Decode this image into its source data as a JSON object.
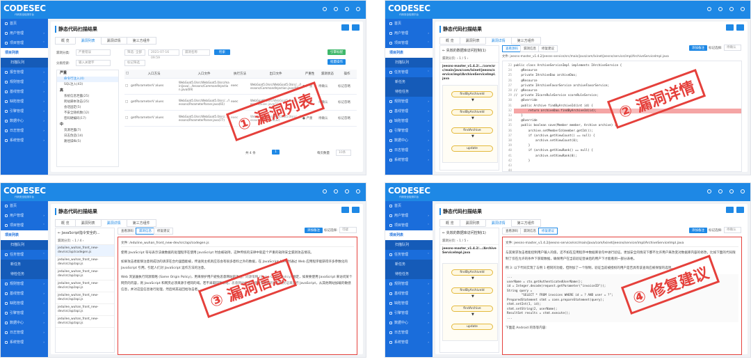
{
  "app": {
    "logo": "CODESEC",
    "logo_sub": "代码安全检测平台",
    "page_title": "静态代码扫描结果"
  },
  "tabs": [
    "概 览",
    "漏洞列表",
    "漏洞详情",
    "第三方组件"
  ],
  "sidebar": {
    "q1": [
      {
        "label": "首页"
      },
      {
        "label": "用户管理",
        "arrow": "›"
      },
      {
        "label": "项目管理",
        "arrow": "˅"
      },
      {
        "label": "项目列表",
        "active": true
      },
      {
        "label": "扫描队列",
        "sub": true
      },
      {
        "label": "报告管理",
        "arrow": "›"
      },
      {
        "label": "规则管理",
        "arrow": "›"
      },
      {
        "label": "基线管理",
        "arrow": "›"
      },
      {
        "label": "缺陷管理",
        "arrow": "›"
      },
      {
        "label": "引擎管理",
        "arrow": "›"
      },
      {
        "label": "数据中心",
        "arrow": "›"
      },
      {
        "label": "日志管理",
        "arrow": "›"
      },
      {
        "label": "系统管理",
        "arrow": "›"
      }
    ],
    "q2": [
      {
        "label": "首页"
      },
      {
        "label": "用户管理",
        "arrow": "›"
      },
      {
        "label": "项目管理",
        "arrow": "˅"
      },
      {
        "label": "项目列表",
        "active": true
      },
      {
        "label": "扫描队列",
        "sub": true
      },
      {
        "label": "任务管理",
        "arrow": "˅"
      },
      {
        "label": "新任务",
        "sub": true
      },
      {
        "label": "待检任务",
        "sub": true
      },
      {
        "label": "规则管理",
        "arrow": "›"
      },
      {
        "label": "基线管理",
        "arrow": "›"
      },
      {
        "label": "缺陷管理",
        "arrow": "›"
      },
      {
        "label": "引擎管理",
        "arrow": "›"
      },
      {
        "label": "数据中心",
        "arrow": "›"
      },
      {
        "label": "日志管理",
        "arrow": "›"
      },
      {
        "label": "系统管理",
        "arrow": "›"
      }
    ],
    "q3": [
      {
        "label": "首页"
      },
      {
        "label": "用户管理",
        "arrow": "›"
      },
      {
        "label": "项目管理",
        "arrow": "˅"
      },
      {
        "label": "项目列表",
        "active": true
      },
      {
        "label": "扫描队列",
        "sub": true
      },
      {
        "label": "任务管理",
        "arrow": "˅"
      },
      {
        "label": "新任务",
        "sub": true
      },
      {
        "label": "待检任务",
        "sub": true
      },
      {
        "label": "规则管理",
        "arrow": "›"
      },
      {
        "label": "基线管理",
        "arrow": "›"
      },
      {
        "label": "缺陷管理",
        "arrow": "›"
      },
      {
        "label": "引擎管理",
        "arrow": "›"
      },
      {
        "label": "数据中心",
        "arrow": "›"
      },
      {
        "label": "日志管理",
        "arrow": "›"
      },
      {
        "label": "系统管理",
        "arrow": "›"
      }
    ],
    "q4": [
      {
        "label": "首页"
      },
      {
        "label": "用户管理",
        "arrow": "›"
      },
      {
        "label": "项目管理",
        "arrow": "˅"
      },
      {
        "label": "项目列表",
        "active": true
      },
      {
        "label": "扫描队列",
        "sub": true
      },
      {
        "label": "任务管理",
        "arrow": "˅"
      },
      {
        "label": "新任务",
        "sub": true
      },
      {
        "label": "待检任务",
        "sub": true
      },
      {
        "label": "规则管理",
        "arrow": "›"
      },
      {
        "label": "基线管理",
        "arrow": "›"
      },
      {
        "label": "缺陷管理",
        "arrow": "›"
      },
      {
        "label": "引擎管理",
        "arrow": "›"
      },
      {
        "label": "数据中心",
        "arrow": "›"
      },
      {
        "label": "日志管理",
        "arrow": "›"
      },
      {
        "label": "系统管理",
        "arrow": "›"
      }
    ]
  },
  "q1": {
    "filter_label": "漏洞分类:",
    "filter_value": "严重错误",
    "class_label": "分类检索:",
    "class_placeholder": "输入关键字",
    "search_mode": "筛选: 全部",
    "date_value": "2021-07-16 09:59",
    "search_placeholder": "漏洞名称",
    "search_btn": "检索",
    "export_btn": "引擎标配",
    "export2_btn": "批量操作",
    "tree": [
      {
        "h": "严重"
      },
      {
        "t": "命令行注入(4)",
        "sel": true
      },
      {
        "t": "SQL注入(43)"
      },
      {
        "h": "高"
      },
      {
        "t": "系统信息泄露(25)"
      },
      {
        "t": "跨站脚本攻击(25)"
      },
      {
        "t": "会话固定(5)"
      },
      {
        "t": "不安全随机数(12)"
      },
      {
        "t": "密码硬编码(17)"
      },
      {
        "h": "中"
      },
      {
        "t": "资源泄露(7)"
      },
      {
        "t": "日志伪造(14)"
      },
      {
        "t": "路径操纵(5)"
      }
    ],
    "headers": [
      "入口方法",
      "入口文件",
      "执行方法",
      "出口文件",
      "严重性",
      "漏洞状态",
      "操作"
    ],
    "rows": [
      {
        "m": "getParameterV alues",
        "f": "WebGoat5.0/src/WebGoat5.0/src/main/java/.../lessons/CommandInjection.java(69)",
        "x": "exec",
        "o": "WebGoat5.0/src/WebGoat5.0/src/.../lessons/CommandInjection.java(98)",
        "s": "● 严重",
        "st": "待确认",
        "op": "标记忽略"
      },
      {
        "m": "getParameterV alues",
        "f": "WebGoat5.0/src/WebGoat5.0/src/.../lessons/ParameterParser.java(65)",
        "x": "exec",
        "o": "WebGoat5.0/src/WebGoat5.0/src/.../lessons/Exec.java(51)",
        "s": "● 严重",
        "st": "待确认",
        "op": "标记忽略"
      },
      {
        "m": "getParameterV alues",
        "f": "WebGoat5.0/src/WebGoat5.0/src/.../lessons/ParameterParser.java(77)",
        "x": "exec",
        "o": "WebGoat5.0/src/WebGoat5.0/src/.../lessons/Exec.java(32)",
        "s": "● 严重",
        "st": "待确认",
        "op": "标记忽略"
      }
    ],
    "pager": {
      "total": "共 4 条",
      "page": "1",
      "size_label": "每页数量",
      "size": "10条"
    },
    "stamp": "① 漏洞列表"
  },
  "q2": {
    "back": "失效的数据库访问控制(1)",
    "nav_label": "漏洞分页:",
    "page": "1",
    "of": "/ 5",
    "file": "jeesns-master_v1.4.2/.../core/src/main/java/com/lxinet/jeesns/service/impl/ArchiveServiceImpl.java",
    "subtabs": [
      "查看源码",
      "漏洞信息",
      "修复建议"
    ],
    "mark_btn": "添加备注",
    "mark_label": "标记选择:",
    "mark_value": "待确认",
    "code_path": "文件: jeesns-master_v1.4.2/jeesns-service/src/main/java/com/lxinet/jeesns/service/impl/ArchiveServiceImpl.java",
    "flow": [
      "findByArchiveId",
      "findByArchiveId",
      "findArchive",
      "update"
    ],
    "lines": [
      "23",
      "24",
      "25",
      "26",
      "27",
      "28",
      "29",
      "30",
      "31",
      "32",
      "33",
      "34",
      "35",
      "36",
      "37",
      "38",
      "39",
      "40",
      "41",
      "42",
      "43",
      "44"
    ],
    "code": [
      "public class ArchiveServiceImpl implements IArchiveService {",
      "    @Resource",
      "    private IArchiveDao archiveDao;",
      "    @Resource",
      "    private IArchiveFavorService archiveFavorService;",
      "//  @Resource",
      "//  private IScoreRuleService scoreRuleService;",
      "",
      "    @Override",
      "    public Archive findByArchiveId(int id) {",
      "        return archiveDao.findByArchiveId(id);",
      "    }",
      "",
      "    @Override",
      "    public boolean save(Member member, Archive archive) {",
      "        archive.setMemberId(member.getId());",
      "        if (archive.getViewCount() == null) {",
      "            archive.setViewCount(0);",
      "        }",
      "        if (archive.getViewRank() == null) {",
      "            archive.setViewRank(0);",
      "        }"
    ],
    "stamp": "② 漏洞详情"
  },
  "q3": {
    "back": "JavaScript指令安全的...",
    "nav_label": "漏洞分页:",
    "page": "1",
    "of": "/ 4",
    "files": [
      "jeduilee_wuhan_front_new-dev/src/api/codegen.js",
      "jeduilee_wuhan_front_new-dev/src/api/api.js",
      "jeduilee_wuhan_front_new-dev/src/api/api.js",
      "jeduilee_wuhan_front_new-dev/src/api/api.js",
      "jeduilee_wuhan_front_new-dev/src/api/api.js",
      "jeduilee_wuhan_front_new-dev/src/api/api.js",
      "jeduilee_wuhan_front_new-dev/src/api/api.js"
    ],
    "subtabs": [
      "查看源码",
      "漏洞信息",
      "修复建议"
    ],
    "mark_btn": "添加备注",
    "mark_label": "标记选择:",
    "mark_value": "可疑",
    "path": "文件: /eduline_wuhan_front_new-dev/src/api/codegen.js",
    "paras": [
      "使用 JavaScript 符号表示法做数据的处理程序在使用 JavaScript 时会被劫持，这种传统的法律中就是个严重的劫持安全漏洞攻击情况。",
      "如果攻击者能够注意到成功的请求在合约里面能被，传送到主机则应答会有很多意料之外的数据，在 JavaScript Ajax 时通过 Web 应用程序能获得许多参数化的 JavaScript 引用，引起人们对 JavaScript 运作方法的注意。",
      "Web 浏览器执行同源策略 (Same Origin Policy)，用来保护用户避免恶意网站的攻击。同源策略 (Same Origin Policy) 规定，如果要使用 JavaScript 来访问某个网页的内容，则 JavaScript 和网页必须来源于相同的域。若不采取同源策略，恶意网站便可以使用受害者的客户端凭证来运行 JavaScript，从其他网站加载的敏感信息，并对这些信息进行处理，然后将其返回给攻击者。"
    ],
    "stamp": "③ 漏洞信息"
  },
  "q4": {
    "back": "失效的数据库访问控制(1)",
    "nav_label": "漏洞分页:",
    "page": "1",
    "of": "/ 5",
    "file": "jeesns-master_v1.4.2/.../ArchiveServiceImpl.java",
    "subtabs": [
      "查看源码",
      "漏洞信息",
      "修复建议"
    ],
    "mark_btn": "添加备注",
    "mark_label": "标记选择:",
    "mark_value": "待确认",
    "path": "文件: jeesns-master_v1.4.2/jeesns-service/src/main/java/com/lxinet/jeesns/service/impl/ArchiveServiceImpl.java",
    "flow": [
      "findByArchiveId",
      "findByArchiveId",
      "findArchive",
      "update"
    ],
    "para1": "与其要求攻击者能控制用户输入的值，还不如在应用程序中数据库语句中进行验证。更加安全的情况下都不允许用户来改变对数据库内容的修改，比如下面的代码限制了仅在允许的条件下获取数据，确保用户在当前验证登录后的用户下才能看到一部分表格。",
    "para2": "例 3: 以下代码实现了与例 1 相同的功能，但附加了一个限制，验证当前被授权的用户是否具有该查询应被保留的选项。",
    "code": [
      "...",
      "userName = ctx.getAuthenticatedUserName();",
      "id = Integer.decode(request.getParameter(\"invoiceID\"));",
      "String query =",
      "        \"SELECT * FROM invoices WHERE id = ? AND user = ?\";",
      "PreparedStatement stmt = conn.prepareStatement(query);",
      "stmt.setInt(1, id);",
      "stmt.setString(2, userName);",
      "ResultSet results = stmt.execute();",
      "..."
    ],
    "foot": "下面是 Android 的等等内容:",
    "stamp": "④ 修复建议"
  }
}
